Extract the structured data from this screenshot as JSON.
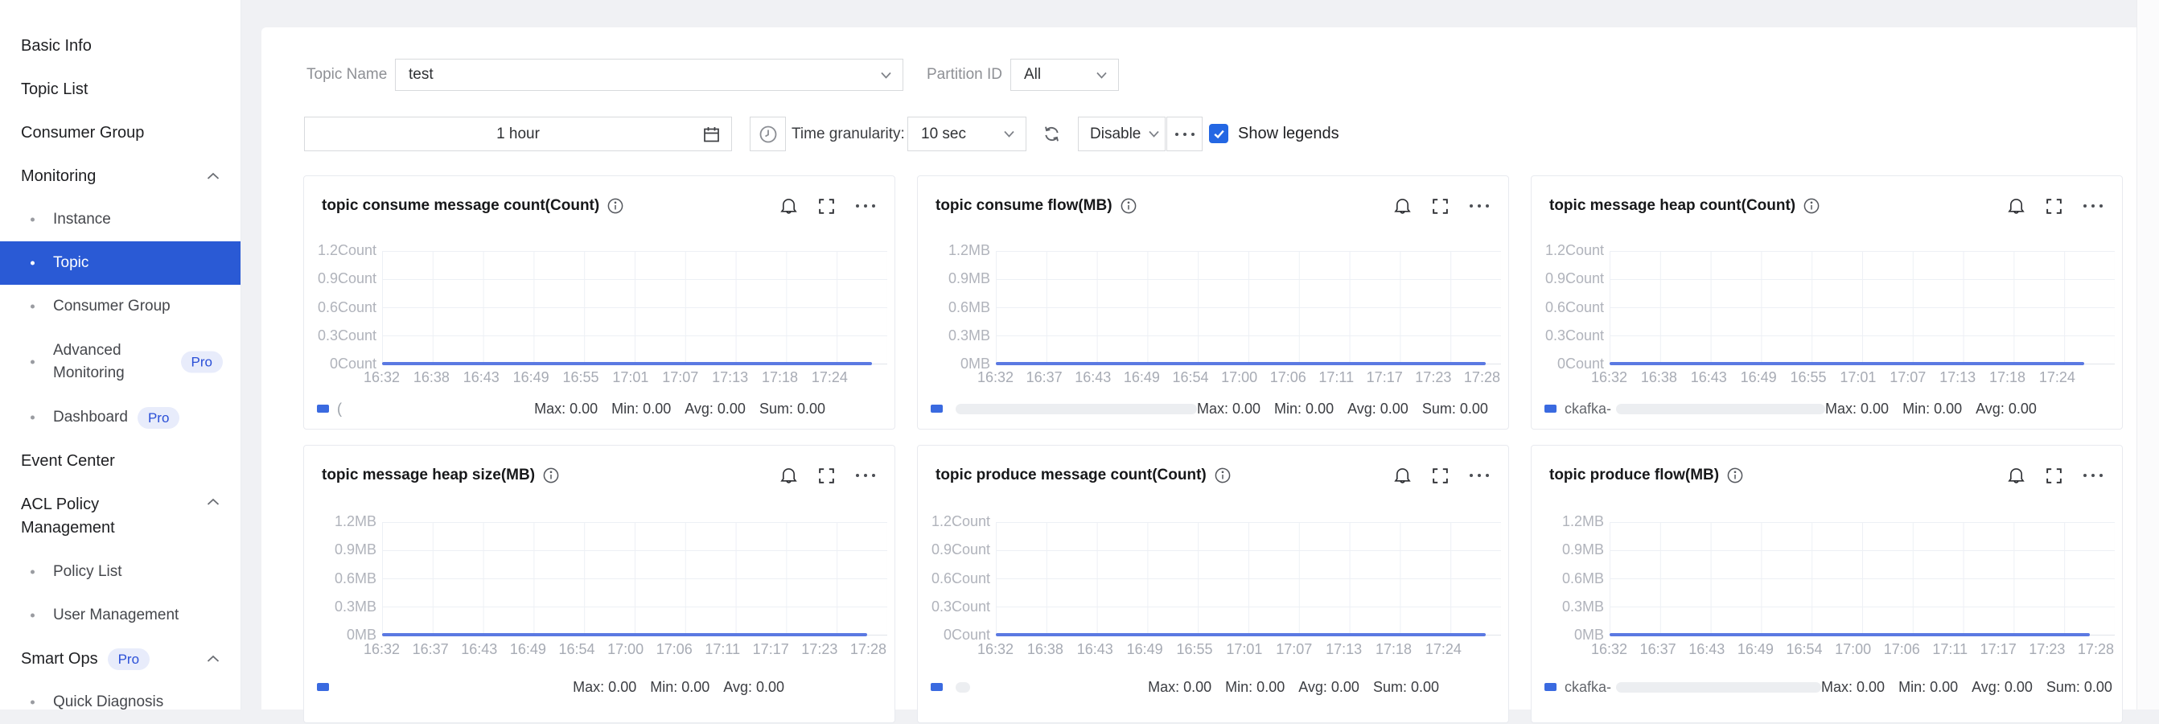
{
  "colors": {
    "accent_blue": "#2a5ad5",
    "chart_line_blue": "#5b79e2",
    "legend_swatch_blue": "#3a6ae0",
    "checkbox_blue": "#2467e3",
    "pro_badge_bg": "#e8ecfb",
    "pro_badge_text": "#2a4fd7"
  },
  "pro_label": "Pro",
  "sidebar": {
    "items": [
      {
        "id": "basic-info",
        "label": "Basic Info",
        "level": "top"
      },
      {
        "id": "topic-list",
        "label": "Topic List",
        "level": "top"
      },
      {
        "id": "consumer-group",
        "label": "Consumer Group",
        "level": "top"
      },
      {
        "id": "monitoring",
        "label": "Monitoring",
        "level": "top",
        "chevron": "up"
      },
      {
        "id": "instance",
        "label": "Instance",
        "level": "sub"
      },
      {
        "id": "topic",
        "label": "Topic",
        "level": "sub",
        "selected": true
      },
      {
        "id": "consumer-group-monitor",
        "label": "Consumer Group",
        "level": "sub"
      },
      {
        "id": "advanced-monitoring",
        "label": "Advanced",
        "label2": "Monitoring",
        "level": "sub",
        "pro": true
      },
      {
        "id": "dashboard",
        "label": "Dashboard",
        "level": "sub",
        "pro": true
      },
      {
        "id": "event-center",
        "label": "Event Center",
        "level": "top"
      },
      {
        "id": "acl-policy-management",
        "label": "ACL Policy",
        "label2": "Management",
        "level": "top",
        "chevron": "up"
      },
      {
        "id": "policy-list",
        "label": "Policy List",
        "level": "sub"
      },
      {
        "id": "user-management",
        "label": "User Management",
        "level": "sub"
      },
      {
        "id": "smart-ops",
        "label": "Smart Ops",
        "level": "top",
        "pro": true,
        "chevron": "up"
      },
      {
        "id": "quick-diagnosis",
        "label": "Quick Diagnosis",
        "level": "sub"
      }
    ]
  },
  "filters": {
    "topic_name": {
      "label": "Topic Name",
      "value": "test"
    },
    "partition_id": {
      "label": "Partition ID",
      "value": "All"
    },
    "time_range": {
      "value": "1 hour"
    },
    "granularity": {
      "label": "Time granularity:",
      "value": "10 sec"
    },
    "refresh_mode": {
      "value": "Disable"
    },
    "show_legends": {
      "label": "Show legends",
      "checked": true
    }
  },
  "chart_data": [
    {
      "type": "line",
      "title": "topic consume message count(Count)",
      "unit": "Count",
      "ylim": [
        0,
        1.2
      ],
      "grid": true,
      "legend_position": "bottom",
      "y_ticks": [
        "1.2Count",
        "0.9Count",
        "0.6Count",
        "0.3Count",
        "0Count"
      ],
      "x_ticks": [
        "16:32",
        "16:38",
        "16:43",
        "16:49",
        "16:55",
        "17:01",
        "17:07",
        "17:13",
        "17:18",
        "17:24"
      ],
      "series": [
        {
          "name_visible": "(",
          "name_truncated": true,
          "constant_value": 0
        }
      ],
      "stats": [
        {
          "label": "Max:",
          "value": "0.00"
        },
        {
          "label": "Min:",
          "value": "0.00"
        },
        {
          "label": "Avg:",
          "value": "0.00"
        },
        {
          "label": "Sum:",
          "value": "0.00"
        }
      ]
    },
    {
      "type": "line",
      "title": "topic consume flow(MB)",
      "unit": "MB",
      "ylim": [
        0,
        1.2
      ],
      "grid": true,
      "legend_position": "bottom",
      "y_ticks": [
        "1.2MB",
        "0.9MB",
        "0.6MB",
        "0.3MB",
        "0MB"
      ],
      "x_ticks": [
        "16:32",
        "16:37",
        "16:43",
        "16:49",
        "16:54",
        "17:00",
        "17:06",
        "17:11",
        "17:17",
        "17:23",
        "17:28"
      ],
      "series": [
        {
          "name_visible": "",
          "name_truncated": true,
          "constant_value": 0
        }
      ],
      "stats": [
        {
          "label": "Max:",
          "value": "0.00"
        },
        {
          "label": "Min:",
          "value": "0.00"
        },
        {
          "label": "Avg:",
          "value": "0.00"
        },
        {
          "label": "Sum:",
          "value": "0.00"
        }
      ]
    },
    {
      "type": "line",
      "title": "topic message heap count(Count)",
      "unit": "Count",
      "ylim": [
        0,
        1.2
      ],
      "grid": true,
      "legend_position": "bottom",
      "y_ticks": [
        "1.2Count",
        "0.9Count",
        "0.6Count",
        "0.3Count",
        "0Count"
      ],
      "x_ticks": [
        "16:32",
        "16:38",
        "16:43",
        "16:49",
        "16:55",
        "17:01",
        "17:07",
        "17:13",
        "17:18",
        "17:24"
      ],
      "series": [
        {
          "name_visible": "ckafka-",
          "name_truncated": true,
          "constant_value": 0
        }
      ],
      "stats": [
        {
          "label": "Max:",
          "value": "0.00"
        },
        {
          "label": "Min:",
          "value": "0.00"
        },
        {
          "label": "Avg:",
          "value": "0.00"
        }
      ]
    },
    {
      "type": "line",
      "title": "topic message heap size(MB)",
      "unit": "MB",
      "ylim": [
        0,
        1.2
      ],
      "grid": true,
      "legend_position": "bottom",
      "y_ticks": [
        "1.2MB",
        "0.9MB",
        "0.6MB",
        "0.3MB",
        "0MB"
      ],
      "x_ticks": [
        "16:32",
        "16:37",
        "16:43",
        "16:49",
        "16:54",
        "17:00",
        "17:06",
        "17:11",
        "17:17",
        "17:23",
        "17:28"
      ],
      "series": [
        {
          "name_visible": "",
          "name_truncated": true,
          "constant_value": 0
        }
      ],
      "stats": [
        {
          "label": "Max:",
          "value": "0.00"
        },
        {
          "label": "Min:",
          "value": "0.00"
        },
        {
          "label": "Avg:",
          "value": "0.00"
        }
      ]
    },
    {
      "type": "line",
      "title": "topic produce message count(Count)",
      "unit": "Count",
      "ylim": [
        0,
        1.2
      ],
      "grid": true,
      "legend_position": "bottom",
      "y_ticks": [
        "1.2Count",
        "0.9Count",
        "0.6Count",
        "0.3Count",
        "0Count"
      ],
      "x_ticks": [
        "16:32",
        "16:38",
        "16:43",
        "16:49",
        "16:55",
        "17:01",
        "17:07",
        "17:13",
        "17:18",
        "17:24"
      ],
      "series": [
        {
          "name_visible": "",
          "name_truncated": true,
          "constant_value": 0
        }
      ],
      "stats": [
        {
          "label": "Max:",
          "value": "0.00"
        },
        {
          "label": "Min:",
          "value": "0.00"
        },
        {
          "label": "Avg:",
          "value": "0.00"
        },
        {
          "label": "Sum:",
          "value": "0.00"
        }
      ]
    },
    {
      "type": "line",
      "title": "topic produce flow(MB)",
      "unit": "MB",
      "ylim": [
        0,
        1.2
      ],
      "grid": true,
      "legend_position": "bottom",
      "y_ticks": [
        "1.2MB",
        "0.9MB",
        "0.6MB",
        "0.3MB",
        "0MB"
      ],
      "x_ticks": [
        "16:32",
        "16:37",
        "16:43",
        "16:49",
        "16:54",
        "17:00",
        "17:06",
        "17:11",
        "17:17",
        "17:23",
        "17:28"
      ],
      "series": [
        {
          "name_visible": "ckafka-",
          "name_truncated": true,
          "constant_value": 0
        }
      ],
      "stats": [
        {
          "label": "Max:",
          "value": "0.00"
        },
        {
          "label": "Min:",
          "value": "0.00"
        },
        {
          "label": "Avg:",
          "value": "0.00"
        },
        {
          "label": "Sum:",
          "value": "0.00"
        }
      ]
    }
  ]
}
